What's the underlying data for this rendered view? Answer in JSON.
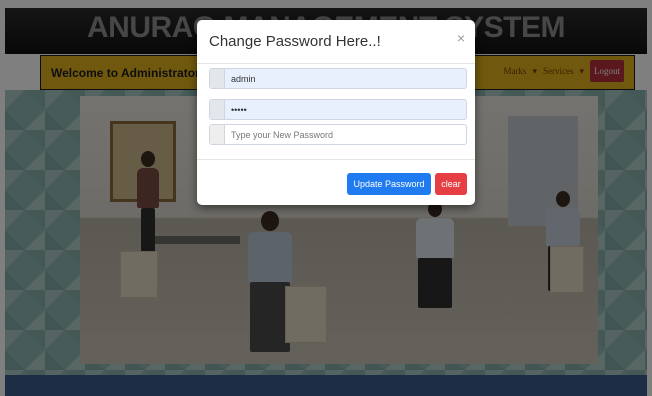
{
  "site": {
    "title": "ANURAG MANAGEMENT SYSTEM"
  },
  "navbar": {
    "welcome": "Welcome to Administrator!",
    "links": [
      "Marks",
      "Services"
    ],
    "logout_label": "Logout"
  },
  "modal": {
    "title": "Change Password Here..!",
    "close_glyph": "×",
    "username_value": "admin",
    "old_password_value": "admin",
    "new_password_placeholder": "Type your New Password",
    "update_label": "Update Password",
    "clear_label": "clear"
  },
  "colors": {
    "navbar": "#e1b21c",
    "logout": "#b52f3b",
    "update_button": "#1f7bef",
    "clear_button": "#e53f44",
    "footer": "#3a5a8c"
  }
}
